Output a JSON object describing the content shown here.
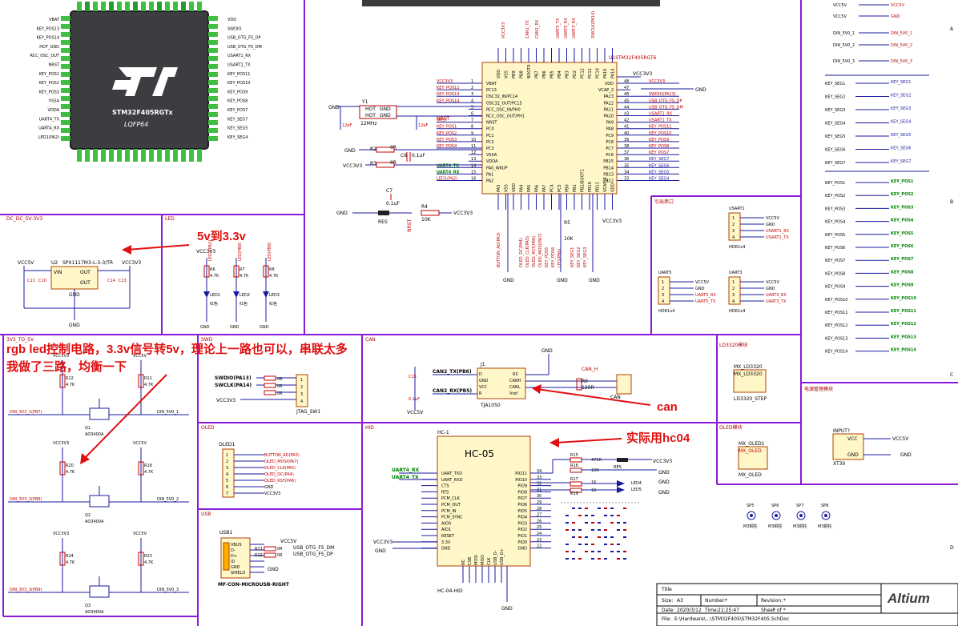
{
  "mcu_image": {
    "part": "STM32F405RGTx",
    "package": "LQFP64",
    "logo_text": "ST",
    "left_pins": [
      "VBAT",
      "KEY_POS13",
      "KEY_POS14",
      "HOT_GND",
      "RCC_OSC_OUT",
      "NRST",
      "KEY_POS1",
      "KEY_POS2",
      "KEY_POS3",
      "VSSA",
      "VDDA",
      "UART4_TX",
      "UART4_RX",
      "LED1(PA2)"
    ],
    "right_pins": [
      "VDD",
      "SWDIO",
      "USB_OTG_FS_DP",
      "USB_OTG_FS_DM",
      "USART1_RX",
      "USART1_TX",
      "KEY_POS11",
      "KEY_POS10",
      "KEY_POS9",
      "KEY_POS8",
      "KEY_POS7",
      "KEY_SEG7",
      "KEY_SEG5",
      "KEY_SEG4"
    ]
  },
  "sections": {
    "dcdc": "DC_DC_5V-3V3",
    "led": "LED",
    "level": "3V3_TO_5V",
    "swd": "SWD",
    "can": "CAN",
    "oled": "OLED",
    "hid": "HID",
    "usb": "USB",
    "uart_header": "引出串口",
    "ld3320": "LD3320模块",
    "oled_module": "OLED模块",
    "power_module": "电源管理模块"
  },
  "annotations": {
    "a1": "5v到3.3v",
    "a2_line1": "rgb led控制电路，3.3v信号转5v，理论上一路也可以，串联太多",
    "a2_line2": "我做了三路，均衡一下",
    "a3": "can",
    "a4": "实际用hc04"
  },
  "mcu": {
    "ref": "U1STM32F405RGT6",
    "left_pins": [
      {
        "num": "1",
        "name": "VBAT",
        "net": "VCC3V3"
      },
      {
        "num": "2",
        "name": "PC13",
        "net": "KEY_POS12"
      },
      {
        "num": "3",
        "name": "OSC32_IN/PC14",
        "net": "KEY_POS13"
      },
      {
        "num": "4",
        "name": "OSC32_OUT/PC15",
        "net": "KEY_POS14"
      },
      {
        "num": "5",
        "name": "RCC_OSC_IN/PH0",
        "net": ""
      },
      {
        "num": "6",
        "name": "RCC_OSC_OUT/PH1",
        "net": ""
      },
      {
        "num": "7",
        "name": "NRST",
        "net": "NRST"
      },
      {
        "num": "8",
        "name": "PC0",
        "net": "KEY_POS1"
      },
      {
        "num": "9",
        "name": "PC1",
        "net": "KEY_POS2"
      },
      {
        "num": "10",
        "name": "PC2",
        "net": "KEY_POS3"
      },
      {
        "num": "11",
        "name": "PC3",
        "net": "KEY_POS4"
      },
      {
        "num": "12",
        "name": "VSSA",
        "net": ""
      },
      {
        "num": "13",
        "name": "VDDA",
        "net": ""
      },
      {
        "num": "14",
        "name": "PA0_WKUP",
        "net": "UART4_TX"
      },
      {
        "num": "15",
        "name": "PA1",
        "net": "UART4_RX"
      },
      {
        "num": "16",
        "name": "PA2",
        "net": "LED1(PA2)"
      }
    ],
    "right_pins": [
      {
        "num": "48",
        "name": "VDD",
        "net": "VCC3V3"
      },
      {
        "num": "47",
        "name": "VCAP_2",
        "net": ""
      },
      {
        "num": "46",
        "name": "PA13",
        "net": "SWDIO(PA13)"
      },
      {
        "num": "45",
        "name": "PA12",
        "net": "USB_OTG_FS_DP"
      },
      {
        "num": "44",
        "name": "PA11",
        "net": "USB_OTG_FS_DM"
      },
      {
        "num": "43",
        "name": "PA10",
        "net": "USART1_RX"
      },
      {
        "num": "42",
        "name": "PA9",
        "net": "USART1_TX"
      },
      {
        "num": "41",
        "name": "PA8",
        "net": "KEY_POS11"
      },
      {
        "num": "40",
        "name": "PC9",
        "net": "KEY_POS10"
      },
      {
        "num": "39",
        "name": "PC8",
        "net": "KEY_POS9"
      },
      {
        "num": "38",
        "name": "PC7",
        "net": "KEY_POS8"
      },
      {
        "num": "37",
        "name": "PC6",
        "net": "KEY_POS7"
      },
      {
        "num": "36",
        "name": "PB15",
        "net": "KEY_SEG7"
      },
      {
        "num": "35",
        "name": "PB14",
        "net": "KEY_SEG6"
      },
      {
        "num": "34",
        "name": "PB13",
        "net": "KEY_SEG5"
      },
      {
        "num": "33",
        "name": "PB12",
        "net": "KEY_SEG4"
      }
    ],
    "top_pins": [
      "VDD",
      "VSS",
      "PB9",
      "PB8",
      "BOOT0",
      "PB7",
      "PB6",
      "PB5",
      "PB4",
      "PB3",
      "PD2",
      "PC12",
      "PC11",
      "PC10",
      "PA15",
      "PA14"
    ],
    "top_nets": [
      "VCC3V3",
      "CAN1_TX",
      "CAN1_RX",
      "UART5_TX",
      "UART5_RX",
      "UART3_RX",
      "SWCLK(PA14)"
    ],
    "bottom_pins": [
      "PA3",
      "VSS",
      "VDD",
      "PA4",
      "PA5",
      "PA6",
      "PA7",
      "PC4",
      "PC5",
      "PB0",
      "PB1",
      "PB2/BOOT1",
      "PB10",
      "PB11",
      "VCAP_1",
      "VDD"
    ],
    "bottom_nets": [
      "BUTTON_AD(PA3)",
      "OLED_DC(PA4)",
      "OLED_CLK(PA5)",
      "OLED_RST(PA6)",
      "OLED_MOSI(PA7)",
      "KEY_POS5",
      "KEY_POS6",
      "LED(PB0)",
      "KEY_SEG1",
      "KEY_SEG2",
      "KEY_SEG3"
    ]
  },
  "crystal": {
    "ref": "Y1",
    "value": "12MHz",
    "pins": [
      "HOT",
      "GND",
      "HOT",
      "GND"
    ],
    "c1": "12pF",
    "c2": "12pF"
  },
  "misc_parts": {
    "r2": "R2",
    "r2v": "0R",
    "r3": "R3",
    "r3v": "0R",
    "c6": "C6",
    "c6v": "0.1uF",
    "c7": "C7",
    "c7v": "0.1uF",
    "r4": "R4",
    "r4v": "10K",
    "res": "RES",
    "vcc3v3": "VCC3V3",
    "vcc5v": "VCC5V",
    "gnd": "GND",
    "nrst": "NRST",
    "r5": "R5",
    "r5v": "10K"
  },
  "right_nets": {
    "top": [
      "VCC5V",
      "VCC5V",
      "DIN_5V0_1",
      "DIN_5V0_2",
      "DIN_5V0_3"
    ],
    "top_right": [
      "VCC5V",
      "GND",
      "DIN_5V0_1",
      "DIN_5V0_2",
      "DIN_5V0_3"
    ],
    "seg_left": [
      "KEY_SEG1",
      "KEY_SEG2",
      "KEY_SEG3",
      "KEY_SEG4",
      "KEY_SEG5",
      "KEY_SEG6",
      "KEY_SEG7"
    ],
    "seg_right": [
      "KEY_SEG1",
      "KEY_SEG2",
      "KEY_SEG3",
      "KEY_SEG4",
      "KEY_SEG5",
      "KEY_SEG6",
      "KEY_SEG7"
    ],
    "pos_left": [
      "KEY_POS1",
      "KEY_POS2",
      "KEY_POS3",
      "KEY_POS4",
      "KEY_POS5",
      "KEY_POS6",
      "KEY_POS7",
      "KEY_POS8",
      "KEY_POS9",
      "KEY_POS10",
      "KEY_POS11",
      "KEY_POS12",
      "KEY_POS13",
      "KEY_POS14"
    ],
    "pos_right": [
      "KEY_POS1",
      "KEY_POS2",
      "KEY_POS3",
      "KEY_POS4",
      "KEY_POS5",
      "KEY_POS6",
      "KEY_POS7",
      "KEY_POS8",
      "KEY_POS9",
      "KEY_POS10",
      "KEY_POS11",
      "KEY_POS12",
      "KEY_POS13",
      "KEY_POS14"
    ]
  },
  "dcdc": {
    "ref": "U2",
    "part": "SPX1117M3-L-3-3/TR",
    "vin": "VIN",
    "out1": "OUT",
    "out2": "OUT",
    "gnd": "GND",
    "caps": [
      "C11",
      "C10",
      "C14",
      "C13"
    ],
    "capv": "10uF"
  },
  "leds": [
    {
      "r": "R6",
      "rv": "4.7K",
      "d": "LED1",
      "color": "红色"
    },
    {
      "r": "R7",
      "rv": "4.7K",
      "d": "LED2",
      "color": "红色"
    },
    {
      "r": "R8",
      "rv": "4.7K",
      "d": "LED3",
      "color": "红色"
    }
  ],
  "led_nets": [
    "LED1(PA2)",
    "LED(PB0)",
    "LED(PB0)"
  ],
  "level_shift": [
    {
      "in": "DIN_3V3_1(PB7)",
      "out": "DIN_5V0_1",
      "q": "Q1",
      "qp": "AO3400A",
      "r1": "R12",
      "r2": "R11",
      "rv": "4.7K"
    },
    {
      "in": "DIN_3V3_2(PB8)",
      "out": "DIN_5V0_2",
      "q": "Q2",
      "qp": "AO3400A",
      "r1": "R20",
      "r2": "R18",
      "rv": "4.7K"
    },
    {
      "in": "DIN_3V3_3(PB9)",
      "out": "DIN_5V0_3",
      "q": "Q3",
      "qp": "AO3400A",
      "r1": "R24",
      "r2": "R23",
      "rv": "4.7K"
    }
  ],
  "swd": {
    "nets": [
      "SWDIO(PA13)",
      "SWCLK(PA14)",
      "VCC3V3"
    ],
    "res": [
      "R11",
      "R12",
      "R13"
    ],
    "rv": "0R",
    "conn": "JTAG_SW1"
  },
  "can": {
    "ref": "J1",
    "part": "TJA1050",
    "pins_l": [
      "D",
      "GND",
      "VCC",
      "R"
    ],
    "pins_r": [
      "RS",
      "CANH",
      "CANL",
      "Vref"
    ],
    "nets": [
      "CAN2_TX(PB6)",
      "CAN2_RX(PB5)"
    ],
    "r": "R9",
    "rv": "120R",
    "h": "CAN_H",
    "c": "C15",
    "cv": "0.1uF",
    "conn": "P3",
    "connname": "CAN"
  },
  "oled": {
    "ref": "OLED1",
    "nets": [
      "BUTTON_AD(PA3)",
      "OLED_MOSI(PA7)",
      "OLED_CLK(PA5)",
      "OLED_DC(PA4)",
      "OLED_RST(PA6)",
      "GND",
      "VCC3V3"
    ]
  },
  "hc05": {
    "ref": "HC-1",
    "title": "HC-05",
    "foot": "HC-04-HID",
    "left": [
      "UART_TXD",
      "UART_RXD",
      "CTS",
      "RTS",
      "PCM_CLK",
      "PCM_OUT",
      "PCM_IN",
      "PCM_SYNC",
      "AIO0",
      "AIO1",
      "RESET",
      "3.3V",
      "GND"
    ],
    "right": [
      "PIO11",
      "PIO10",
      "PIO9",
      "PIO8",
      "PIO7",
      "PIO6",
      "PIO5",
      "PIO4",
      "PIO3",
      "PIO2",
      "PIO1",
      "PIO0",
      "GND"
    ],
    "bottom": [
      "NC",
      "CSB",
      "MOSI",
      "MISO",
      "CLK",
      "USB_D-",
      "USB_D+"
    ],
    "nets": [
      "UART4_RX",
      "UART4_TX"
    ],
    "parts": [
      "R15",
      "470R",
      "R16",
      "10K",
      "R17",
      "1K",
      "R19",
      "1K",
      "LED4",
      "LED5",
      "RES"
    ]
  },
  "usb": {
    "ref": "USB1",
    "part": "MF-CON-MICROUSB-RIGHT",
    "pins": [
      "VBUS",
      "D-",
      "D+",
      "ID",
      "GND",
      "SHIELD"
    ],
    "nets": [
      "USB_OTG_FS_DM",
      "USB_OTG_FS_DP",
      "VCC5V",
      "GND"
    ],
    "r": [
      "R21",
      "R22"
    ],
    "rv": "0R"
  },
  "uart": {
    "usart1": {
      "ref": "USART1",
      "pins": [
        "VCC5V",
        "GND",
        "USART1_RX",
        "USART1_TX"
      ],
      "foot": "HDR1x4"
    },
    "uart5": {
      "ref": "UART5",
      "pins": [
        "VCC5V",
        "GND",
        "UART5_RX",
        "UART5_TX"
      ],
      "foot": "HDR1x4"
    },
    "uart3": {
      "ref": "UART3",
      "pins": [
        "VCC5V",
        "GND",
        "UART3_RX",
        "UART3_TX"
      ],
      "foot": "HDR1x4"
    }
  },
  "ld3320": {
    "ref": "MX_LD3320",
    "name": "MX_LD3320",
    "foot": "LD3320_STEP"
  },
  "oled_mod": {
    "ref": "MX_OLED1",
    "name": "MX_OLED",
    "foot": "MX_OLED"
  },
  "power": {
    "ref": "INPUT?",
    "p1": "VCC",
    "p2": "GND",
    "net1": "VCC5V",
    "net2": "GND",
    "foot": "XT30"
  },
  "mount": [
    {
      "ref": "SP5",
      "v": "M3铜柱"
    },
    {
      "ref": "SP6",
      "v": "M3铜柱"
    },
    {
      "ref": "SP7",
      "v": "M3铜柱"
    },
    {
      "ref": "SP8",
      "v": "M3铜柱"
    }
  ],
  "title_block": {
    "title": "Title",
    "size_l": "Size:",
    "size": "A3",
    "number_l": "Number:",
    "number": "*",
    "rev_l": "Revision:",
    "rev": "*",
    "date_l": "Date:",
    "date": "2020/3/12",
    "time_l": "Time:",
    "time": "21:25:47",
    "sheet_l": "Sheet",
    "sheet": "* of *",
    "file_l": "File:",
    "file": "E:\\Hardware\\...\\STM32F405\\STM32F405.SchDoc",
    "logo": "Altium"
  },
  "zones": [
    "A",
    "B",
    "C",
    "D"
  ]
}
